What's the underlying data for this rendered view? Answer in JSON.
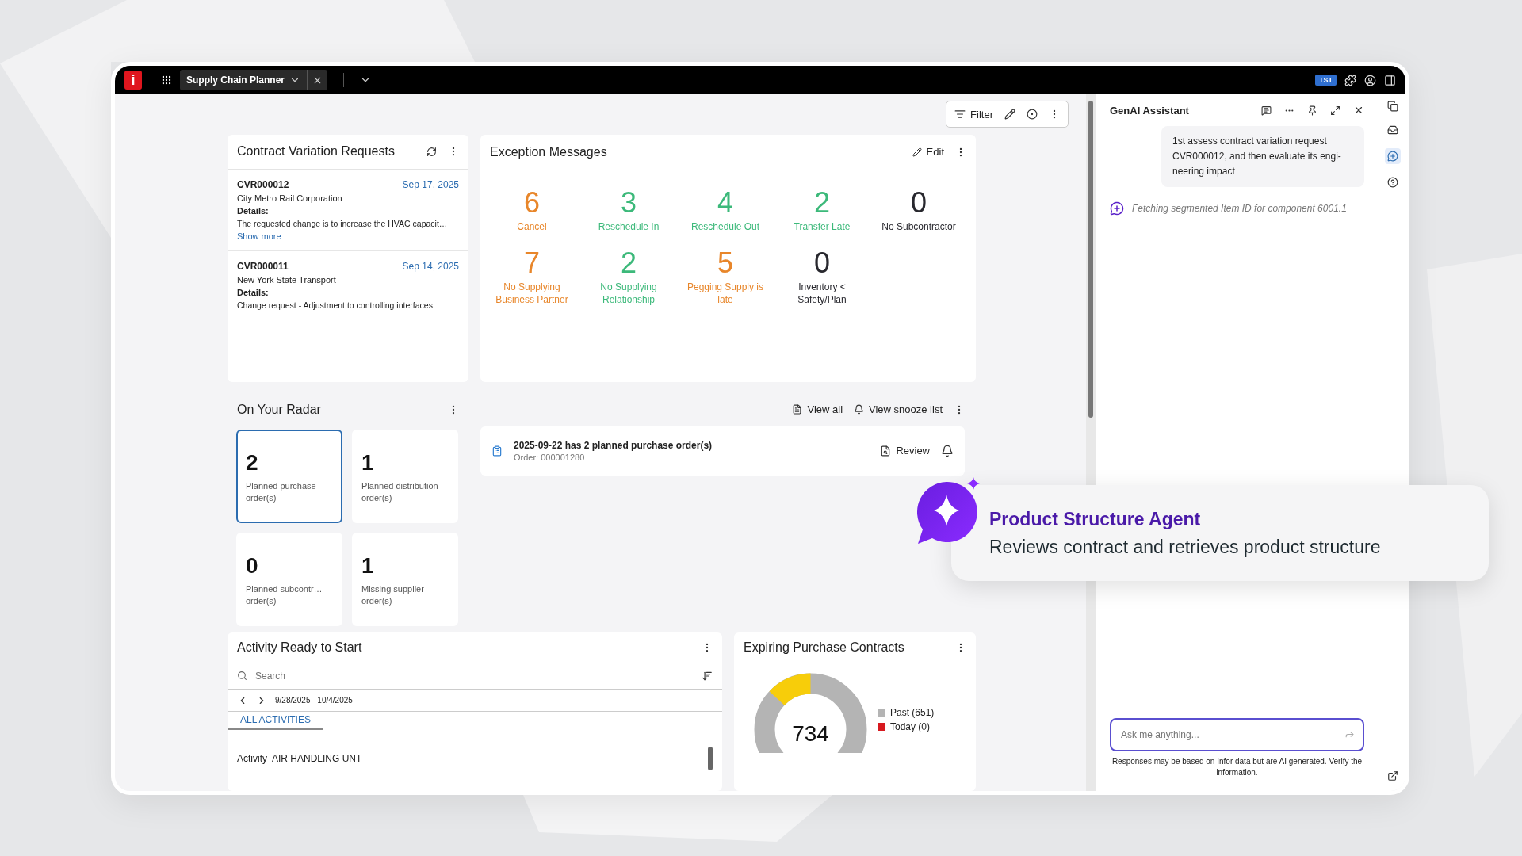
{
  "app_bar": {
    "logo": "i",
    "tab": "Supply Chain Planner",
    "badge": "TST"
  },
  "toolbar": {
    "filter": "Filter"
  },
  "contract_requests": {
    "title": "Contract Variation Requests",
    "items": [
      {
        "id": "CVR000012",
        "date": "Sep 17, 2025",
        "company": "City Metro Rail Corporation",
        "details_label": "Details:",
        "details": "The requested change is to increase the HVAC capacit…",
        "link": "Show more"
      },
      {
        "id": "CVR000011",
        "date": "Sep 14, 2025",
        "company": "New York State Transport",
        "details_label": "Details:",
        "details": "Change request - Adjustment to controlling interfaces."
      }
    ]
  },
  "exception_messages": {
    "title": "Exception Messages",
    "edit": "Edit",
    "items": [
      {
        "count": "6",
        "label": "Cancel",
        "color": "#e8862a"
      },
      {
        "count": "3",
        "label": "Reschedule In",
        "color": "#3cb97a"
      },
      {
        "count": "4",
        "label": "Reschedule Out",
        "color": "#3cb97a"
      },
      {
        "count": "2",
        "label": "Transfer Late",
        "color": "#3cb97a"
      },
      {
        "count": "0",
        "label": "No Subcontractor",
        "color": "#28282e"
      },
      {
        "count": "7",
        "label": "No Supplying Business Partner",
        "color": "#e8862a"
      },
      {
        "count": "2",
        "label": "No Supplying Relationship",
        "color": "#3cb97a"
      },
      {
        "count": "5",
        "label": "Pegging Supply is late",
        "color": "#e8862a"
      },
      {
        "count": "0",
        "label": "Inventory < Safety/Plan",
        "color": "#28282e"
      }
    ]
  },
  "radar": {
    "title": "On Your Radar",
    "view_all": "View all",
    "view_snooze": "View snooze list",
    "tiles": [
      {
        "count": "2",
        "label": "Planned purchase order(s)",
        "selected": true
      },
      {
        "count": "1",
        "label": "Planned distribution order(s)",
        "selected": false
      },
      {
        "count": "0",
        "label": "Planned subcontr… order(s)",
        "selected": false
      },
      {
        "count": "1",
        "label": "Missing supplier order(s)",
        "selected": false
      }
    ],
    "notification": {
      "title": "2025-09-22 has 2 planned purchase order(s)",
      "order": "Order: 000001280",
      "review": "Review"
    }
  },
  "activity": {
    "title": "Activity Ready to Start",
    "search_placeholder": "Search",
    "date_range": "9/28/2025 - 10/4/2025",
    "filter": "ALL ACTIVITIES",
    "rows": [
      {
        "label": "Activity",
        "value": "AIR HANDLING UNT"
      }
    ]
  },
  "expiring": {
    "title": "Expiring Purchase Contracts",
    "total": "734",
    "legend": [
      {
        "label": "Past (651)",
        "color": "#b4b4b4"
      },
      {
        "label": "Today (0)",
        "color": "#d7191f"
      }
    ]
  },
  "assistant": {
    "title": "GenAI Assistant",
    "user_message": "1st assess contract variation request CVR000012, and then evaluate its engi-neering impact",
    "status": "Fetching segmented Item ID for component 6001.1",
    "input_placeholder": "Ask me anything...",
    "disclaimer": "Responses may be based on Infor data but are AI generated. Verify the information."
  },
  "callout": {
    "title": "Product Structure Agent",
    "subtitle": "Reviews contract and retrieves product structure"
  }
}
